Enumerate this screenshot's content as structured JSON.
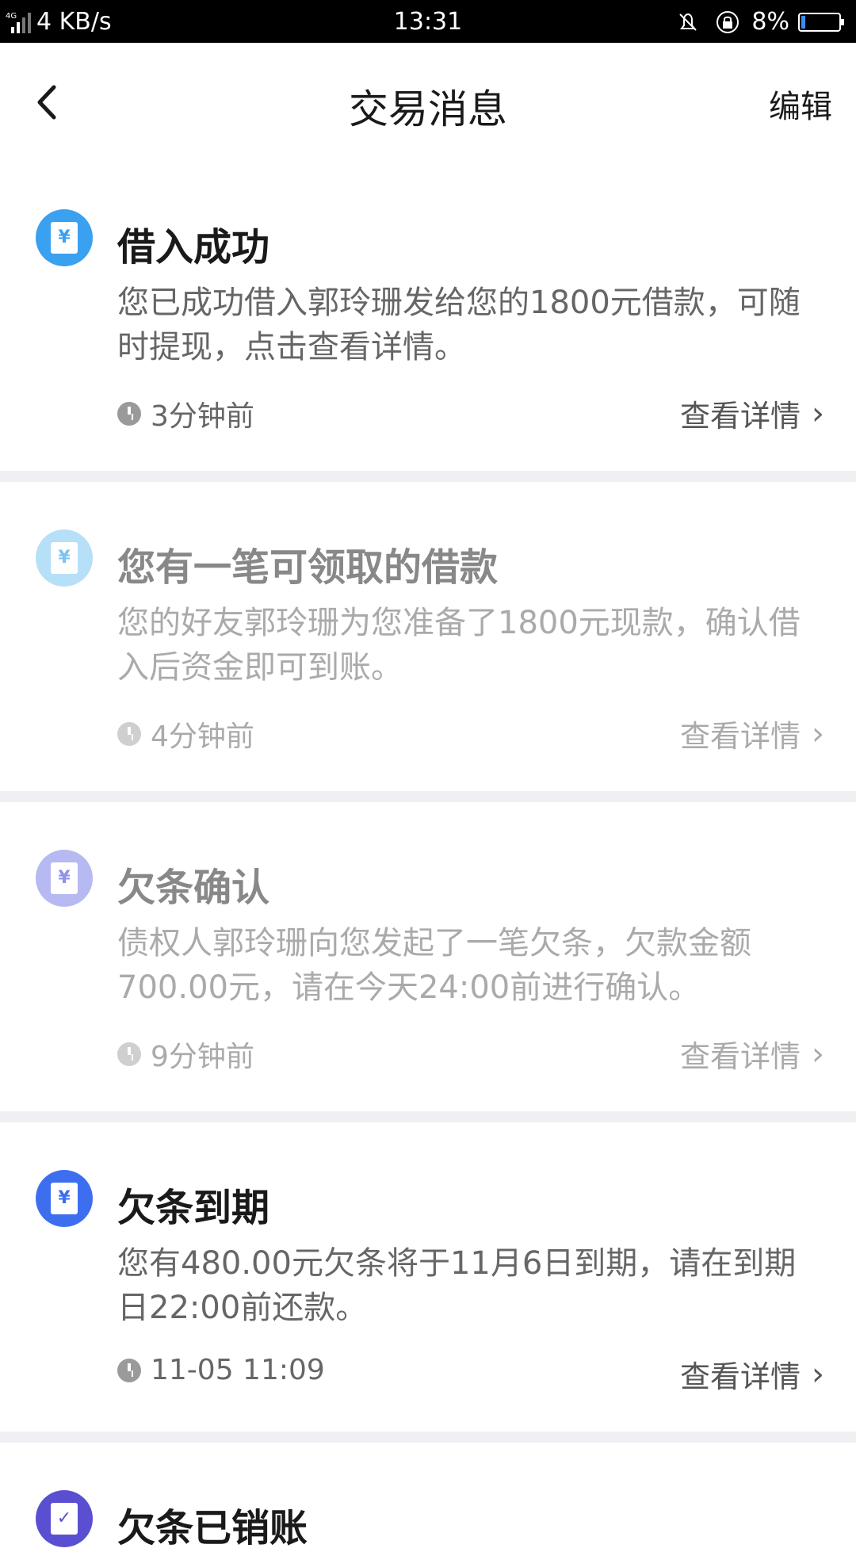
{
  "status_bar": {
    "network": "4G",
    "speed": "4 KB/s",
    "time": "13:31",
    "battery": "8%"
  },
  "header": {
    "title": "交易消息",
    "edit": "编辑"
  },
  "messages": [
    {
      "title": "借入成功",
      "body": "您已成功借入郭玲珊发给您的1800元借款，可随时提现，点击查看详情。",
      "time": "3分钟前",
      "detail": "查看详情",
      "icon_color": "#3aa0f0",
      "icon": "receipt-yuan-icon"
    },
    {
      "title": "您有一笔可领取的借款",
      "body": "您的好友郭玲珊为您准备了1800元现款，确认借入后资金即可到账。",
      "time": "4分钟前",
      "detail": "查看详情",
      "icon_color": "#b6dff8",
      "icon": "receipt-yuan-icon"
    },
    {
      "title": "欠条确认",
      "body": "债权人郭玲珊向您发起了一笔欠条，欠款金额700.00元，请在今天24:00前进行确认。",
      "time": "9分钟前",
      "detail": "查看详情",
      "icon_color": "#b7b9f3",
      "icon": "receipt-yuan-icon"
    },
    {
      "title": "欠条到期",
      "body": "您有480.00元欠条将于11月6日到期，请在到期日22:00前还款。",
      "time": "11-05 11:09",
      "detail": "查看详情",
      "icon_color": "#3e6ef0",
      "icon": "receipt-yuan-icon"
    },
    {
      "title": "欠条已销账",
      "icon_color": "#5a4fd1",
      "icon": "receipt-check-icon"
    }
  ]
}
